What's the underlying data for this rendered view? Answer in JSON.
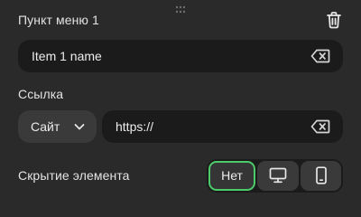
{
  "menu_item": {
    "title": "Пункт меню 1",
    "icons": {
      "drag": "drag-handle-icon",
      "delete": "trash-icon"
    },
    "name_field": {
      "value": "Item 1 name",
      "clear_icon": "backspace-clear-icon"
    },
    "link": {
      "label": "Ссылка",
      "type_select": {
        "selected": "Сайт",
        "icon": "chevron-down-icon"
      },
      "url_field": {
        "value": "https://",
        "clear_icon": "backspace-clear-icon"
      }
    },
    "visibility": {
      "label": "Скрытие элемента",
      "options": [
        {
          "label": "Нет",
          "selected": true
        },
        {
          "icon": "desktop-icon",
          "selected": false
        },
        {
          "icon": "mobile-phone-icon",
          "selected": false
        }
      ]
    }
  },
  "colors": {
    "panel_bg": "#2a2a2a",
    "field_bg": "#1b1b1b",
    "control_bg": "#3a3a3a",
    "accent": "#4ccb6a",
    "text": "#e6e6e6"
  }
}
